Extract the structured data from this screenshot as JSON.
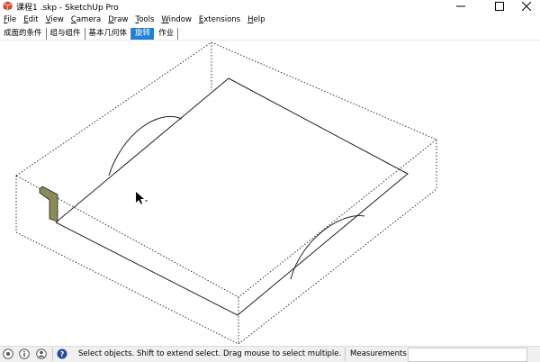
{
  "window": {
    "title": "课程1 .skp - SketchUp Pro",
    "minimize_icon": "minimize-icon",
    "maximize_icon": "maximize-icon",
    "close_icon": "close-icon"
  },
  "menu": {
    "items": [
      {
        "key": "F",
        "rest": "ile"
      },
      {
        "key": "E",
        "rest": "dit"
      },
      {
        "key": "V",
        "rest": "iew"
      },
      {
        "key": "C",
        "rest": "amera"
      },
      {
        "key": "D",
        "rest": "raw"
      },
      {
        "key": "T",
        "rest": "ools"
      },
      {
        "key": "W",
        "rest": "indow"
      },
      {
        "key": "E",
        "rest": "xtensions"
      },
      {
        "key": "H",
        "rest": "elp"
      }
    ]
  },
  "scene_tabs": {
    "items": [
      "成面的条件",
      "组与组件",
      "基本几何体",
      "旋转",
      "作业"
    ],
    "active_index": 3,
    "active_color": "#1e7fd8"
  },
  "viewport": {
    "cursor_icon": "arrow-cursor-icon",
    "profile_color": "#8b8a5a"
  },
  "statusbar": {
    "icons": [
      "geolocation-icon",
      "credits-icon",
      "user-icon",
      "help-icon"
    ],
    "message": "Select objects. Shift to extend select. Drag mouse to select multiple.",
    "measurements_label": "Measurements",
    "measurements_value": ""
  }
}
